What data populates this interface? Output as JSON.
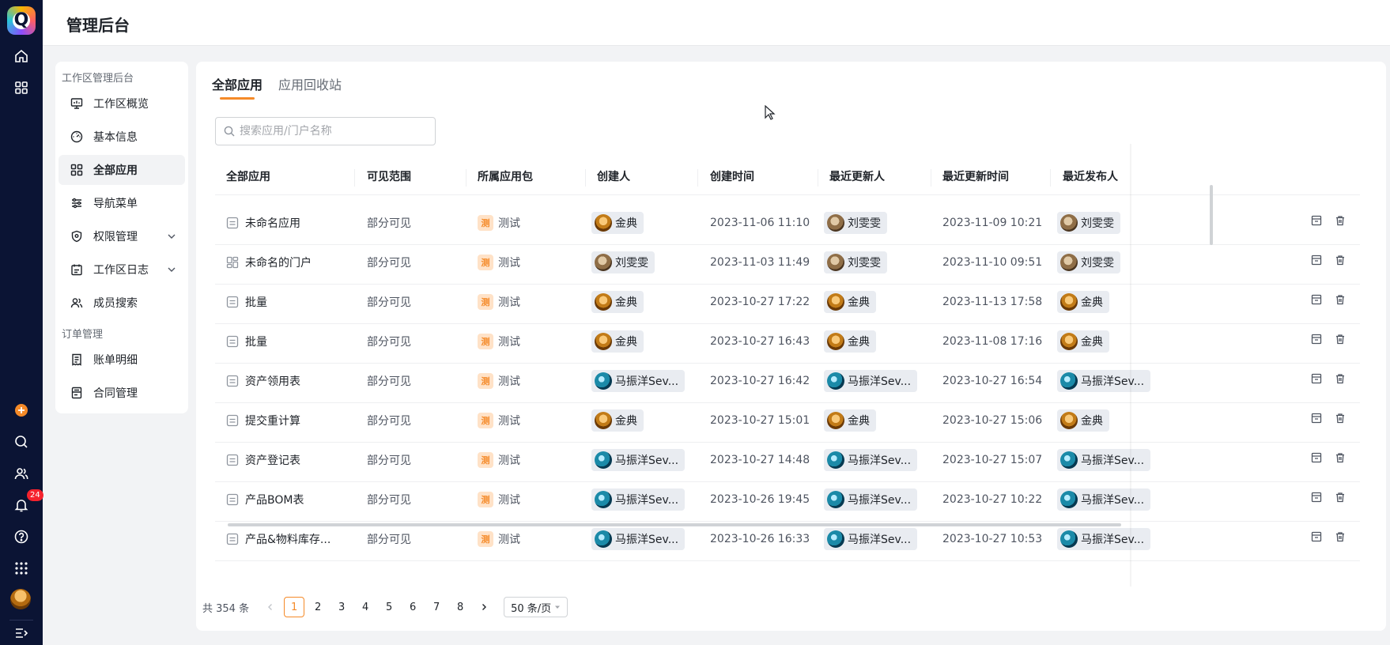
{
  "header": {
    "title": "管理后台"
  },
  "rail": {
    "logo_letter": "Q",
    "notification_count": "24"
  },
  "sidemenu": {
    "group1": "工作区管理后台",
    "items": [
      {
        "label": "工作区概览",
        "icon": "monitor-icon"
      },
      {
        "label": "基本信息",
        "icon": "dashboard-icon"
      },
      {
        "label": "全部应用",
        "icon": "grid-icon"
      },
      {
        "label": "导航菜单",
        "icon": "sliders-icon"
      },
      {
        "label": "权限管理",
        "icon": "shield-icon"
      },
      {
        "label": "工作区日志",
        "icon": "calendar-icon"
      },
      {
        "label": "成员搜索",
        "icon": "users-icon"
      }
    ],
    "group2": "订单管理",
    "items2": [
      {
        "label": "账单明细",
        "icon": "receipt-icon"
      },
      {
        "label": "合同管理",
        "icon": "contract-icon"
      }
    ]
  },
  "tabs": {
    "all": "全部应用",
    "recycle": "应用回收站"
  },
  "search": {
    "placeholder": "搜索应用/门户名称"
  },
  "table": {
    "columns": [
      "全部应用",
      "可见范围",
      "所属应用包",
      "创建人",
      "创建时间",
      "最近更新人",
      "最近更新时间",
      "最近发布人"
    ],
    "rows": [
      {
        "name": "未命名应用",
        "type": "app",
        "scope": "部分可见",
        "pkg": "测试",
        "creator": "金典",
        "creator_av": "gold",
        "created": "2023-11-06 11:10",
        "updater": "刘雯雯",
        "updater_av": "brown",
        "updated": "2023-11-09 10:21",
        "publisher": "刘雯雯",
        "publisher_av": "brown"
      },
      {
        "name": "未命名的门户",
        "type": "portal",
        "scope": "部分可见",
        "pkg": "测试",
        "creator": "刘雯雯",
        "creator_av": "brown",
        "created": "2023-11-03 11:49",
        "updater": "刘雯雯",
        "updater_av": "brown",
        "updated": "2023-11-10 09:51",
        "publisher": "刘雯雯",
        "publisher_av": "brown"
      },
      {
        "name": "批量",
        "type": "app",
        "scope": "部分可见",
        "pkg": "测试",
        "creator": "金典",
        "creator_av": "gold",
        "created": "2023-10-27 17:22",
        "updater": "金典",
        "updater_av": "gold",
        "updated": "2023-11-13 17:58",
        "publisher": "金典",
        "publisher_av": "gold"
      },
      {
        "name": "批量",
        "type": "app",
        "scope": "部分可见",
        "pkg": "测试",
        "creator": "金典",
        "creator_av": "gold",
        "created": "2023-10-27 16:43",
        "updater": "金典",
        "updater_av": "gold",
        "updated": "2023-11-08 17:16",
        "publisher": "金典",
        "publisher_av": "gold"
      },
      {
        "name": "资产领用表",
        "type": "app",
        "scope": "部分可见",
        "pkg": "测试",
        "creator": "马振洋Sev...",
        "creator_av": "teal",
        "created": "2023-10-27 16:42",
        "updater": "马振洋Sev...",
        "updater_av": "teal",
        "updated": "2023-10-27 16:54",
        "publisher": "马振洋Sev...",
        "publisher_av": "teal"
      },
      {
        "name": "提交重计算",
        "type": "app",
        "scope": "部分可见",
        "pkg": "测试",
        "creator": "金典",
        "creator_av": "gold",
        "created": "2023-10-27 15:01",
        "updater": "金典",
        "updater_av": "gold",
        "updated": "2023-10-27 15:06",
        "publisher": "金典",
        "publisher_av": "gold"
      },
      {
        "name": "资产登记表",
        "type": "app",
        "scope": "部分可见",
        "pkg": "测试",
        "creator": "马振洋Sev...",
        "creator_av": "teal",
        "created": "2023-10-27 14:48",
        "updater": "马振洋Sev...",
        "updater_av": "teal",
        "updated": "2023-10-27 15:07",
        "publisher": "马振洋Sev...",
        "publisher_av": "teal"
      },
      {
        "name": "产品BOM表",
        "type": "app",
        "scope": "部分可见",
        "pkg": "测试",
        "creator": "马振洋Sev...",
        "creator_av": "teal",
        "created": "2023-10-26 19:45",
        "updater": "马振洋Sev...",
        "updater_av": "teal",
        "updated": "2023-10-27 10:22",
        "publisher": "马振洋Sev...",
        "publisher_av": "teal"
      },
      {
        "name": "产品&物料库存...",
        "type": "app",
        "scope": "部分可见",
        "pkg": "测试",
        "creator": "马振洋Sev...",
        "creator_av": "teal",
        "created": "2023-10-26 16:33",
        "updater": "马振洋Sev...",
        "updater_av": "teal",
        "updated": "2023-10-27 10:53",
        "publisher": "马振洋Sev...",
        "publisher_av": "teal"
      }
    ]
  },
  "pagination": {
    "total": "共 354 条",
    "pages": [
      "1",
      "2",
      "3",
      "4",
      "5",
      "6",
      "7",
      "8"
    ],
    "current": "1",
    "page_size": "50 条/页"
  }
}
